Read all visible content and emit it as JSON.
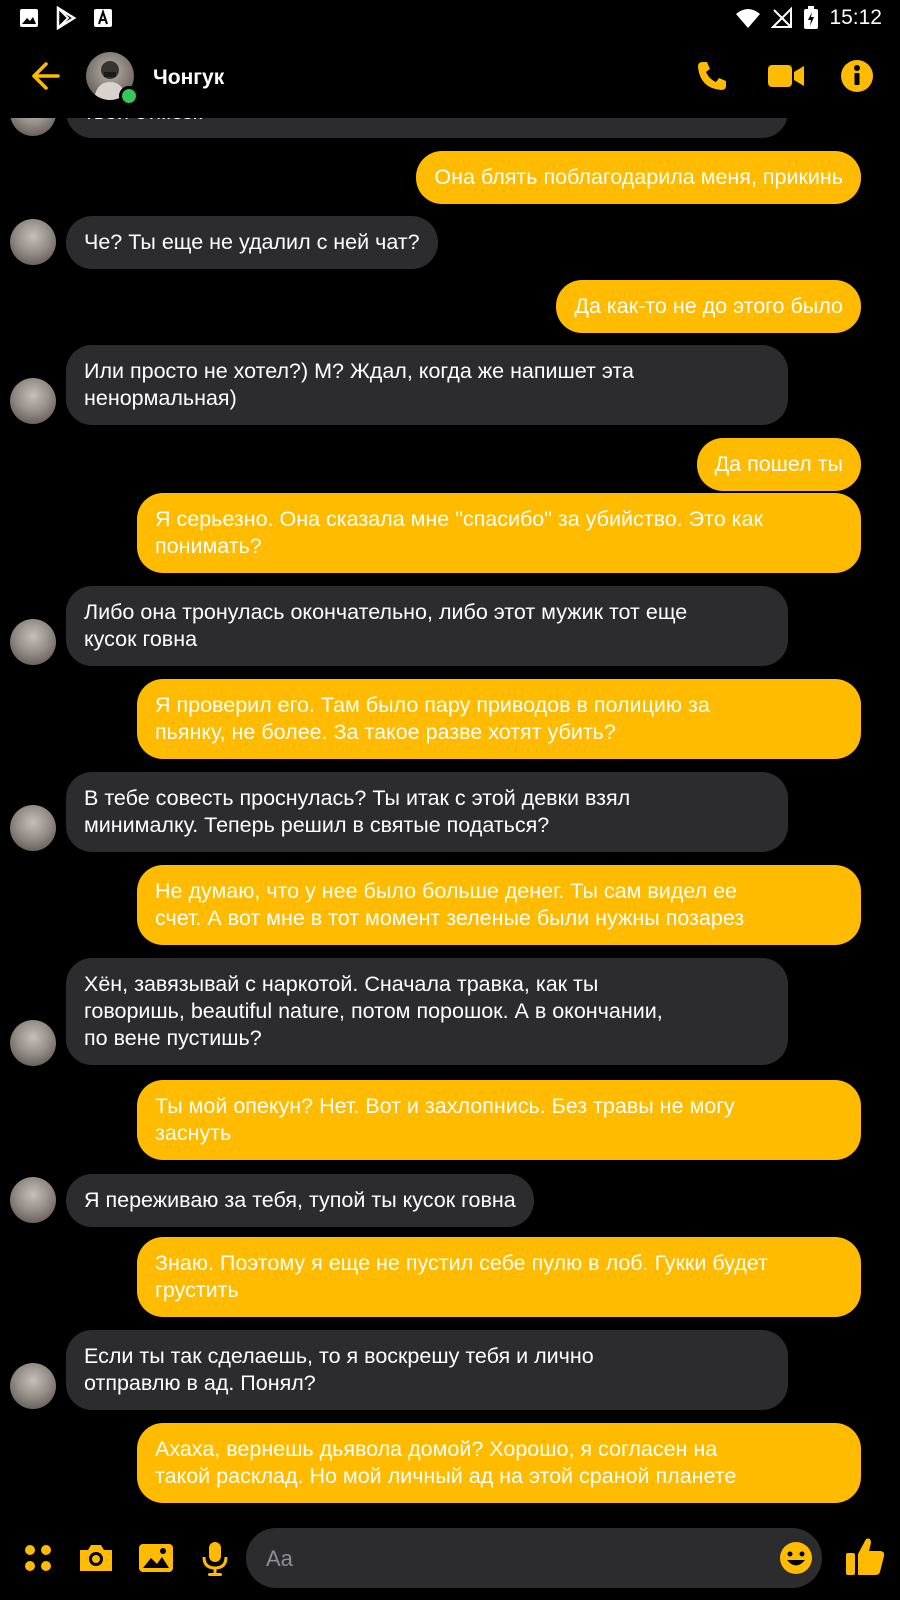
{
  "theme": {
    "accent": "#ffbb00",
    "incoming_bubble": "#2c2c2e",
    "background": "#000000",
    "online": "#34c759"
  },
  "status_bar": {
    "time": "15:12",
    "left_icons": [
      "image-icon",
      "play-store-icon",
      "font-icon"
    ],
    "right_icons": [
      "wifi-icon",
      "signal-icon",
      "battery-icon"
    ]
  },
  "header": {
    "contact_name": "Чонгук",
    "icons": [
      "back-arrow-icon",
      "phone-icon",
      "video-camera-icon",
      "info-icon"
    ]
  },
  "messages": [
    {
      "side": "in",
      "text": "твои отмозк"
    },
    {
      "side": "out",
      "text": "Она блять поблагодарила меня, прикинь"
    },
    {
      "side": "in",
      "text": "Че? Ты еще не удалил с ней чат?"
    },
    {
      "side": "out",
      "text": "Да как-то не до этого было"
    },
    {
      "side": "in",
      "text": "Или просто не хотел?) М? Ждал, когда же напишет эта\nненормальная)"
    },
    {
      "side": "out",
      "text": "Да пошел ты"
    },
    {
      "side": "out",
      "text": "Я серьезно. Она сказала мне \"спасибо\" за убийство. Это как\nпонимать?"
    },
    {
      "side": "in",
      "text": "Либо она тронулась окончательно, либо этот мужик тот еще\nкусок говна"
    },
    {
      "side": "out",
      "text": "Я проверил его. Там было пару приводов в полицию за\nпьянку, не более. За такое разве хотят убить?"
    },
    {
      "side": "in",
      "text": "В тебе совесть проснулась? Ты итак с этой девки взял\nминималку. Теперь решил в святые податься?"
    },
    {
      "side": "out",
      "text": "Не думаю, что у нее было больше денег. Ты сам видел ее\nсчет. А вот мне в тот момент зеленые были нужны позарез"
    },
    {
      "side": "in",
      "text": "Хён, завязывай с наркотой. Сначала травка, как ты\nговоришь, beautiful nature, потом порошок. А в окончании,\nпо вене пустишь?"
    },
    {
      "side": "out",
      "text": "Ты мой опекун? Нет. Вот и захлопнись. Без травы не могу\nзаснуть"
    },
    {
      "side": "in",
      "text": "Я переживаю за тебя, тупой ты кусок говна"
    },
    {
      "side": "out",
      "text": "Знаю. Поэтому я еще не пустил себе пулю в лоб. Гукки будет\nгрустить"
    },
    {
      "side": "in",
      "text": "Если ты так сделаешь, то я воскрешу тебя и лично\nотправлю в ад. Понял?"
    },
    {
      "side": "out",
      "text": "Ахаха, вернешь дьявола домой? Хорошо, я согласен на\nтакой расклад. Но мой личный ад на этой сраной планете"
    }
  ],
  "composer": {
    "placeholder": "Aa",
    "icons": [
      "apps-grid-icon",
      "camera-icon",
      "gallery-icon",
      "microphone-icon",
      "emoji-icon",
      "thumbs-up-icon"
    ]
  }
}
